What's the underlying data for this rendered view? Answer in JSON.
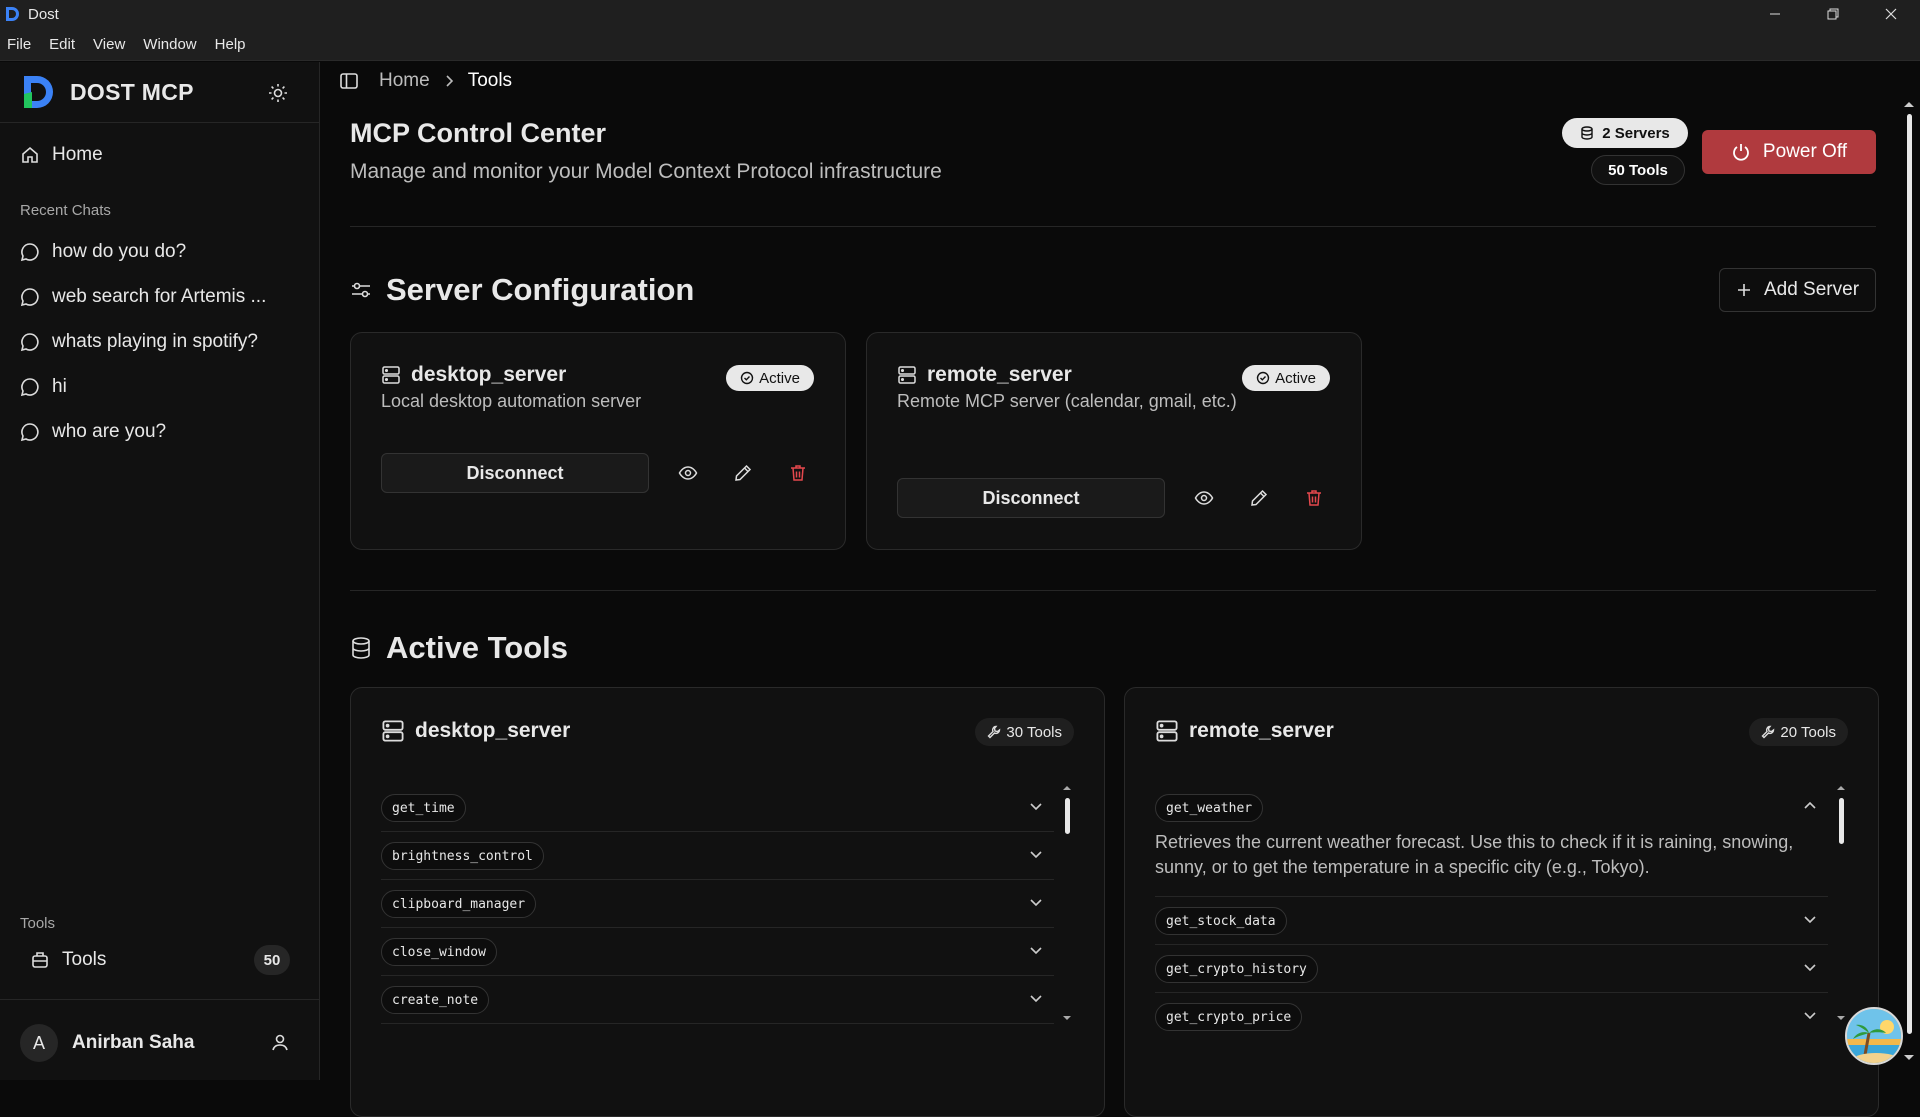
{
  "window": {
    "title": "Dost"
  },
  "menu": [
    "File",
    "Edit",
    "View",
    "Window",
    "Help"
  ],
  "colors": {
    "accent_red": "#b03a3e",
    "delete_red": "#e5484d",
    "brand_blue": "#3b82f6",
    "brand_green": "#22c55e"
  },
  "sidebar": {
    "brand": "DOST MCP",
    "home_label": "Home",
    "recent_label": "Recent Chats",
    "chats": [
      "how do you do?",
      "web search for Artemis ...",
      "whats playing in spotify?",
      "hi",
      "who are you?"
    ],
    "tools_section_label": "Tools",
    "tools_label": "Tools",
    "tools_count": "50",
    "user_initial": "A",
    "user_name": "Anirban Saha"
  },
  "breadcrumb": {
    "home": "Home",
    "current": "Tools"
  },
  "header": {
    "title": "MCP Control Center",
    "subtitle": "Manage and monitor your Model Context Protocol infrastructure",
    "servers_pill": "2 Servers",
    "tools_pill": "50 Tools",
    "power_label": "Power Off"
  },
  "server_config": {
    "title": "Server Configuration",
    "add_label": "Add Server",
    "servers": [
      {
        "name": "desktop_server",
        "desc": "Local desktop automation server",
        "status": "Active",
        "action": "Disconnect"
      },
      {
        "name": "remote_server",
        "desc": "Remote MCP server (calendar, gmail, etc.)",
        "status": "Active",
        "action": "Disconnect"
      }
    ]
  },
  "active_tools": {
    "title": "Active Tools",
    "groups": [
      {
        "name": "desktop_server",
        "count": "30 Tools",
        "tools": [
          "get_time",
          "brightness_control",
          "clipboard_manager",
          "close_window",
          "create_note"
        ]
      },
      {
        "name": "remote_server",
        "count": "20 Tools",
        "tools": [
          "get_weather",
          "get_stock_data",
          "get_crypto_history",
          "get_crypto_price"
        ],
        "expanded_desc": "Retrieves the current weather forecast. Use this to check if it is raining, snowing, sunny, or to get the temperature in a specific city (e.g., Tokyo)."
      }
    ]
  }
}
